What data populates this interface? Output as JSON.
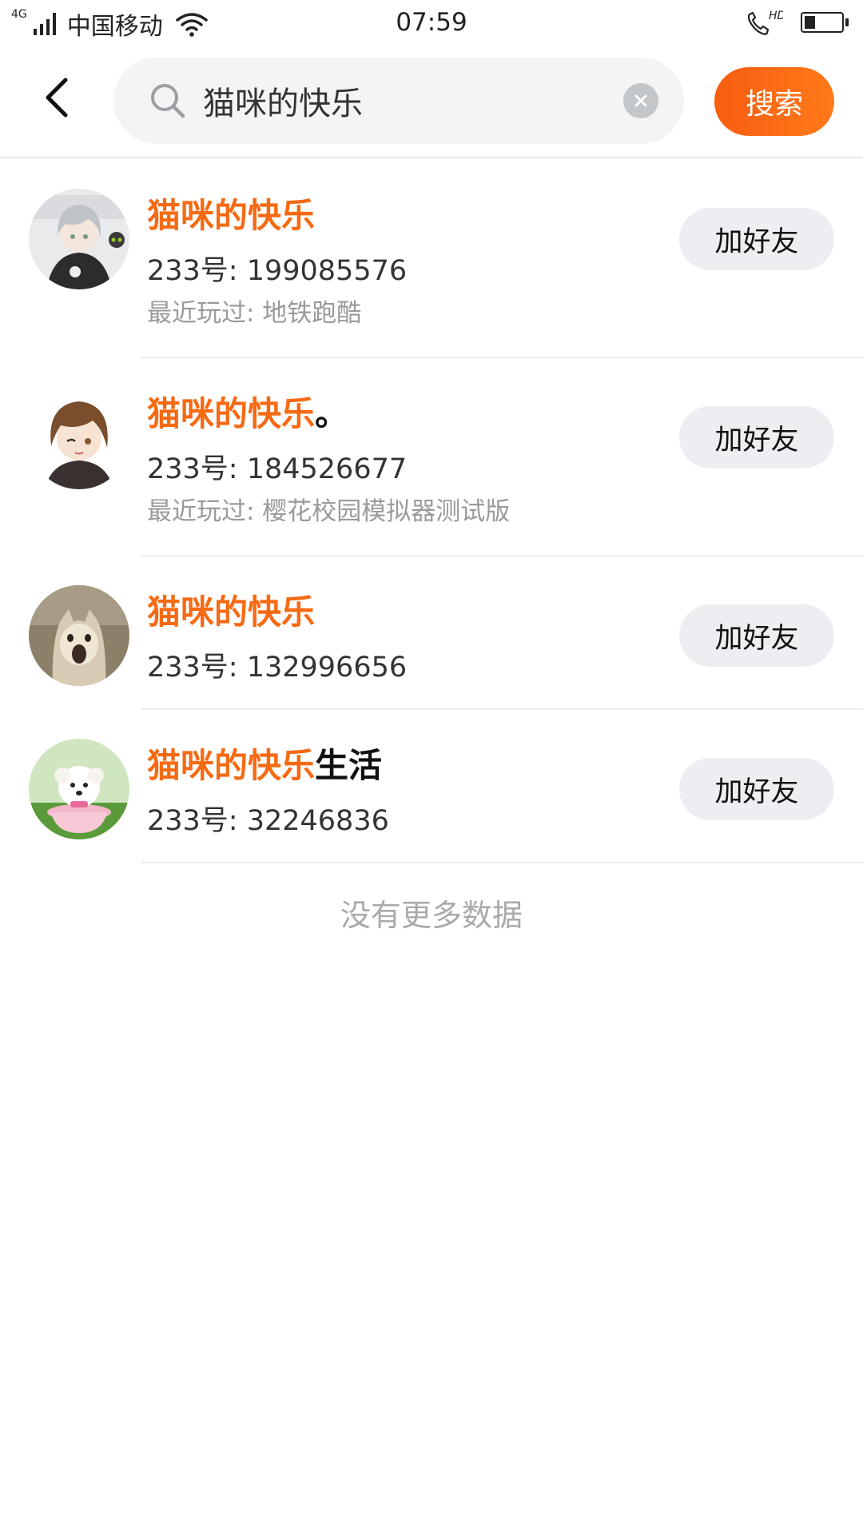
{
  "status_bar": {
    "network_type": "4G",
    "carrier": "中国移动",
    "time": "07:59",
    "hd_label": "HD",
    "battery_level": 0.3
  },
  "search": {
    "query": "猫咪的快乐",
    "submit_label": "搜索"
  },
  "results": [
    {
      "name_highlight": "猫咪的快乐",
      "name_rest": "",
      "uid": "233号: 199085576",
      "recent": "最近玩过: 地铁跑酷",
      "add_label": "加好友",
      "avatar": "anime-girl-avatar"
    },
    {
      "name_highlight": "猫咪的快乐",
      "name_rest": "。",
      "uid": "233号: 184526677",
      "recent": "最近玩过: 樱花校园模拟器测试版",
      "add_label": "加好友",
      "avatar": "anime-brown-hair-avatar"
    },
    {
      "name_highlight": "猫咪的快乐",
      "name_rest": "",
      "uid": "233号: 132996656",
      "recent": "",
      "add_label": "加好友",
      "avatar": "cat-photo-avatar"
    },
    {
      "name_highlight": "猫咪的快乐",
      "name_rest": "生活",
      "uid": "233号: 32246836",
      "recent": "",
      "add_label": "加好友",
      "avatar": "puppy-teacup-avatar"
    }
  ],
  "footer": {
    "no_more": "没有更多数据"
  },
  "colors": {
    "accent": "#f56a13",
    "button_bg": "#eceef2",
    "search_bg": "#f2f4f5"
  }
}
